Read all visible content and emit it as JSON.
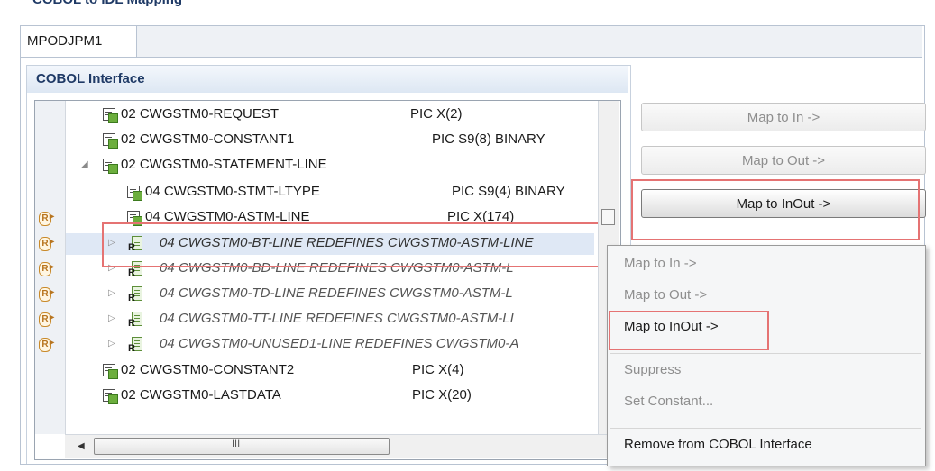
{
  "header": {
    "title_partial": "COBOL to IDL Mapping"
  },
  "tab": {
    "label": "MPODJPM1"
  },
  "section": {
    "title": "COBOL Interface"
  },
  "tree": {
    "rows": [
      {
        "name": "02 CWGSTM0-REQUEST",
        "pic": "PIC X(2)"
      },
      {
        "name": "02 CWGSTM0-CONSTANT1",
        "pic": "PIC S9(8) BINARY"
      },
      {
        "name": "02 CWGSTM0-STATEMENT-LINE",
        "pic": ""
      },
      {
        "name": "04 CWGSTM0-STMT-LTYPE",
        "pic": "PIC S9(4) BINARY"
      },
      {
        "name": "04 CWGSTM0-ASTM-LINE",
        "pic": "PIC X(174)"
      },
      {
        "name": "04 CWGSTM0-BT-LINE REDEFINES CWGSTM0-ASTM-LINE",
        "pic": ""
      },
      {
        "name": "04 CWGSTM0-BD-LINE REDEFINES CWGSTM0-ASTM-L",
        "pic": ""
      },
      {
        "name": "04 CWGSTM0-TD-LINE REDEFINES CWGSTM0-ASTM-L",
        "pic": ""
      },
      {
        "name": "04 CWGSTM0-TT-LINE REDEFINES CWGSTM0-ASTM-LI",
        "pic": ""
      },
      {
        "name": "04 CWGSTM0-UNUSED1-LINE REDEFINES CWGSTM0-A",
        "pic": ""
      },
      {
        "name": "02 CWGSTM0-CONSTANT2",
        "pic": "PIC X(4)"
      },
      {
        "name": "02 CWGSTM0-LASTDATA",
        "pic": "PIC X(20)"
      }
    ],
    "hscroll_grip": "III"
  },
  "buttons": {
    "map_in": "Map to In ->",
    "map_out": "Map to Out ->",
    "map_inout": "Map to InOut ->"
  },
  "context_menu": {
    "map_in": "Map to In ->",
    "map_out": "Map to Out ->",
    "map_inout": "Map to InOut ->",
    "suppress": "Suppress",
    "set_constant": "Set Constant...",
    "remove": "Remove from COBOL Interface"
  },
  "colors": {
    "highlight": "#e57373",
    "section_title": "#1f3a66",
    "selection": "#dfe8f5"
  }
}
